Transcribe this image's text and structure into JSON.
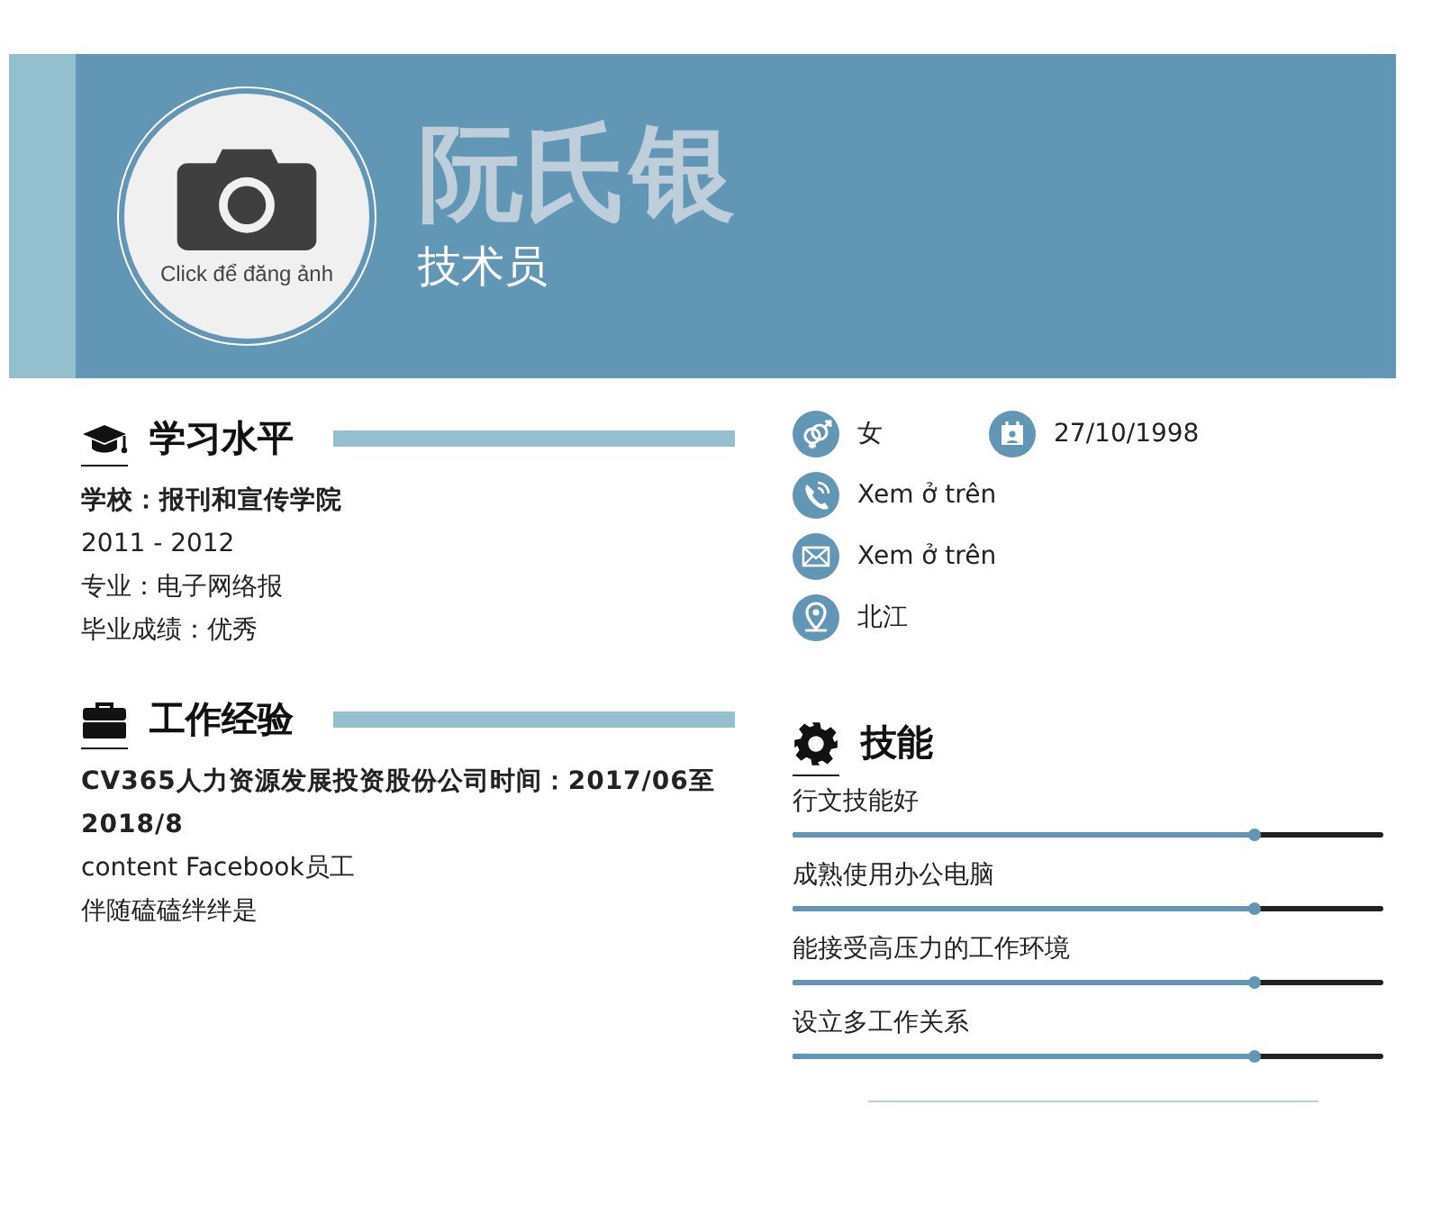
{
  "header": {
    "photo_caption": "Click để đăng ảnh",
    "name": "阮氏银",
    "job_title": "技术员"
  },
  "education": {
    "title": "学习水平",
    "kind": "education",
    "lines": [
      {
        "text": "学校：报刊和宣传学院",
        "kind": "bold"
      },
      {
        "text": "2011 - 2012",
        "kind": "plain"
      },
      {
        "text": "专业：电子网络报",
        "kind": "plain"
      },
      {
        "text": "毕业成绩：优秀",
        "kind": "plain"
      }
    ]
  },
  "experience": {
    "title": "工作经验",
    "kind": "work",
    "lines": [
      {
        "text": "CV365人力资源发展投资股份公司时间：2017/06至2018/8",
        "kind": "bold"
      },
      {
        "text": "content Facebook员工",
        "kind": "plain"
      },
      {
        "text": "伴随磕磕绊绊是",
        "kind": "plain"
      }
    ]
  },
  "personal_info": [
    {
      "items": [
        {
          "kind": "gender",
          "text": "女"
        },
        {
          "kind": "birthday",
          "text": "27/10/1998"
        }
      ]
    },
    {
      "items": [
        {
          "kind": "phone",
          "text": "Xem ở trên"
        }
      ]
    },
    {
      "items": [
        {
          "kind": "email",
          "text": "Xem ở trên"
        }
      ]
    },
    {
      "items": [
        {
          "kind": "address",
          "text": "北江"
        }
      ]
    }
  ],
  "skills": {
    "title": "技能",
    "kind": "skills",
    "items": [
      {
        "name": "行文技能好",
        "level": 0.78
      },
      {
        "name": "成熟使用办公电脑",
        "level": 0.78
      },
      {
        "name": "能接受高压力的工作环境",
        "level": 0.78
      },
      {
        "name": "设立多工作关系",
        "level": 0.78
      }
    ]
  }
}
